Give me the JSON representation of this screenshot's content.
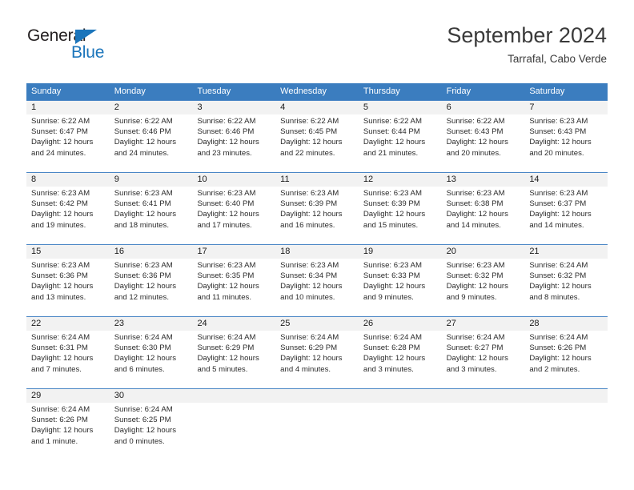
{
  "brand": {
    "name_top": "General",
    "name_bottom": "Blue",
    "accent_color": "#1b75bb"
  },
  "header": {
    "title": "September 2024",
    "subtitle": "Tarrafal, Cabo Verde"
  },
  "theme": {
    "header_row_bg": "#3b7dbf",
    "daynum_row_bg": "#f2f2f2",
    "row_separator": "#4a86c5",
    "text_color": "#2b2b2b"
  },
  "weekdays": [
    "Sunday",
    "Monday",
    "Tuesday",
    "Wednesday",
    "Thursday",
    "Friday",
    "Saturday"
  ],
  "weeks": [
    {
      "numbers": [
        "1",
        "2",
        "3",
        "4",
        "5",
        "6",
        "7"
      ],
      "cells": [
        {
          "sunrise": "Sunrise: 6:22 AM",
          "sunset": "Sunset: 6:47 PM",
          "daylight1": "Daylight: 12 hours",
          "daylight2": "and 24 minutes."
        },
        {
          "sunrise": "Sunrise: 6:22 AM",
          "sunset": "Sunset: 6:46 PM",
          "daylight1": "Daylight: 12 hours",
          "daylight2": "and 24 minutes."
        },
        {
          "sunrise": "Sunrise: 6:22 AM",
          "sunset": "Sunset: 6:46 PM",
          "daylight1": "Daylight: 12 hours",
          "daylight2": "and 23 minutes."
        },
        {
          "sunrise": "Sunrise: 6:22 AM",
          "sunset": "Sunset: 6:45 PM",
          "daylight1": "Daylight: 12 hours",
          "daylight2": "and 22 minutes."
        },
        {
          "sunrise": "Sunrise: 6:22 AM",
          "sunset": "Sunset: 6:44 PM",
          "daylight1": "Daylight: 12 hours",
          "daylight2": "and 21 minutes."
        },
        {
          "sunrise": "Sunrise: 6:22 AM",
          "sunset": "Sunset: 6:43 PM",
          "daylight1": "Daylight: 12 hours",
          "daylight2": "and 20 minutes."
        },
        {
          "sunrise": "Sunrise: 6:23 AM",
          "sunset": "Sunset: 6:43 PM",
          "daylight1": "Daylight: 12 hours",
          "daylight2": "and 20 minutes."
        }
      ]
    },
    {
      "numbers": [
        "8",
        "9",
        "10",
        "11",
        "12",
        "13",
        "14"
      ],
      "cells": [
        {
          "sunrise": "Sunrise: 6:23 AM",
          "sunset": "Sunset: 6:42 PM",
          "daylight1": "Daylight: 12 hours",
          "daylight2": "and 19 minutes."
        },
        {
          "sunrise": "Sunrise: 6:23 AM",
          "sunset": "Sunset: 6:41 PM",
          "daylight1": "Daylight: 12 hours",
          "daylight2": "and 18 minutes."
        },
        {
          "sunrise": "Sunrise: 6:23 AM",
          "sunset": "Sunset: 6:40 PM",
          "daylight1": "Daylight: 12 hours",
          "daylight2": "and 17 minutes."
        },
        {
          "sunrise": "Sunrise: 6:23 AM",
          "sunset": "Sunset: 6:39 PM",
          "daylight1": "Daylight: 12 hours",
          "daylight2": "and 16 minutes."
        },
        {
          "sunrise": "Sunrise: 6:23 AM",
          "sunset": "Sunset: 6:39 PM",
          "daylight1": "Daylight: 12 hours",
          "daylight2": "and 15 minutes."
        },
        {
          "sunrise": "Sunrise: 6:23 AM",
          "sunset": "Sunset: 6:38 PM",
          "daylight1": "Daylight: 12 hours",
          "daylight2": "and 14 minutes."
        },
        {
          "sunrise": "Sunrise: 6:23 AM",
          "sunset": "Sunset: 6:37 PM",
          "daylight1": "Daylight: 12 hours",
          "daylight2": "and 14 minutes."
        }
      ]
    },
    {
      "numbers": [
        "15",
        "16",
        "17",
        "18",
        "19",
        "20",
        "21"
      ],
      "cells": [
        {
          "sunrise": "Sunrise: 6:23 AM",
          "sunset": "Sunset: 6:36 PM",
          "daylight1": "Daylight: 12 hours",
          "daylight2": "and 13 minutes."
        },
        {
          "sunrise": "Sunrise: 6:23 AM",
          "sunset": "Sunset: 6:36 PM",
          "daylight1": "Daylight: 12 hours",
          "daylight2": "and 12 minutes."
        },
        {
          "sunrise": "Sunrise: 6:23 AM",
          "sunset": "Sunset: 6:35 PM",
          "daylight1": "Daylight: 12 hours",
          "daylight2": "and 11 minutes."
        },
        {
          "sunrise": "Sunrise: 6:23 AM",
          "sunset": "Sunset: 6:34 PM",
          "daylight1": "Daylight: 12 hours",
          "daylight2": "and 10 minutes."
        },
        {
          "sunrise": "Sunrise: 6:23 AM",
          "sunset": "Sunset: 6:33 PM",
          "daylight1": "Daylight: 12 hours",
          "daylight2": "and 9 minutes."
        },
        {
          "sunrise": "Sunrise: 6:23 AM",
          "sunset": "Sunset: 6:32 PM",
          "daylight1": "Daylight: 12 hours",
          "daylight2": "and 9 minutes."
        },
        {
          "sunrise": "Sunrise: 6:24 AM",
          "sunset": "Sunset: 6:32 PM",
          "daylight1": "Daylight: 12 hours",
          "daylight2": "and 8 minutes."
        }
      ]
    },
    {
      "numbers": [
        "22",
        "23",
        "24",
        "25",
        "26",
        "27",
        "28"
      ],
      "cells": [
        {
          "sunrise": "Sunrise: 6:24 AM",
          "sunset": "Sunset: 6:31 PM",
          "daylight1": "Daylight: 12 hours",
          "daylight2": "and 7 minutes."
        },
        {
          "sunrise": "Sunrise: 6:24 AM",
          "sunset": "Sunset: 6:30 PM",
          "daylight1": "Daylight: 12 hours",
          "daylight2": "and 6 minutes."
        },
        {
          "sunrise": "Sunrise: 6:24 AM",
          "sunset": "Sunset: 6:29 PM",
          "daylight1": "Daylight: 12 hours",
          "daylight2": "and 5 minutes."
        },
        {
          "sunrise": "Sunrise: 6:24 AM",
          "sunset": "Sunset: 6:29 PM",
          "daylight1": "Daylight: 12 hours",
          "daylight2": "and 4 minutes."
        },
        {
          "sunrise": "Sunrise: 6:24 AM",
          "sunset": "Sunset: 6:28 PM",
          "daylight1": "Daylight: 12 hours",
          "daylight2": "and 3 minutes."
        },
        {
          "sunrise": "Sunrise: 6:24 AM",
          "sunset": "Sunset: 6:27 PM",
          "daylight1": "Daylight: 12 hours",
          "daylight2": "and 3 minutes."
        },
        {
          "sunrise": "Sunrise: 6:24 AM",
          "sunset": "Sunset: 6:26 PM",
          "daylight1": "Daylight: 12 hours",
          "daylight2": "and 2 minutes."
        }
      ]
    },
    {
      "numbers": [
        "29",
        "30",
        "",
        "",
        "",
        "",
        ""
      ],
      "cells": [
        {
          "sunrise": "Sunrise: 6:24 AM",
          "sunset": "Sunset: 6:26 PM",
          "daylight1": "Daylight: 12 hours",
          "daylight2": "and 1 minute."
        },
        {
          "sunrise": "Sunrise: 6:24 AM",
          "sunset": "Sunset: 6:25 PM",
          "daylight1": "Daylight: 12 hours",
          "daylight2": "and 0 minutes."
        },
        {
          "sunrise": "",
          "sunset": "",
          "daylight1": "",
          "daylight2": ""
        },
        {
          "sunrise": "",
          "sunset": "",
          "daylight1": "",
          "daylight2": ""
        },
        {
          "sunrise": "",
          "sunset": "",
          "daylight1": "",
          "daylight2": ""
        },
        {
          "sunrise": "",
          "sunset": "",
          "daylight1": "",
          "daylight2": ""
        },
        {
          "sunrise": "",
          "sunset": "",
          "daylight1": "",
          "daylight2": ""
        }
      ]
    }
  ]
}
